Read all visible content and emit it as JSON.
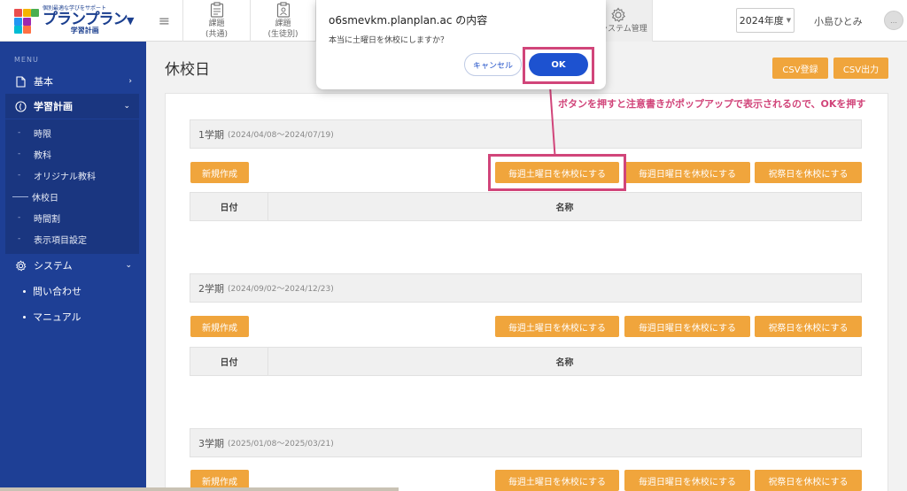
{
  "header": {
    "logo_tagline": "個別最適な学びをサポート",
    "logo_main": "プランプラン",
    "logo_sub": "学習計画",
    "tabs": [
      {
        "label1": "課題",
        "label2": "(共通)"
      },
      {
        "label1": "課題",
        "label2": "(生徒別)"
      }
    ],
    "system_tab_label": "システム管理",
    "year": "2024年度",
    "user_name": "小島ひとみ",
    "avatar_text": "…"
  },
  "sidebar": {
    "menu_label": "MENU",
    "basic": "基本",
    "study_plan": "学習計画",
    "sub_items": [
      "時限",
      "教科",
      "オリジナル教科",
      "休校日",
      "時間割",
      "表示項目設定"
    ],
    "system": "システム",
    "inquiry": "問い合わせ",
    "manual": "マニュアル"
  },
  "page": {
    "title": "休校日",
    "csv_import": "CSV登録",
    "csv_export": "CSV出力"
  },
  "terms": [
    {
      "name": "1学期",
      "dates": "(2024/04/08〜2024/07/19)"
    },
    {
      "name": "2学期",
      "dates": "(2024/09/02〜2024/12/23)"
    },
    {
      "name": "3学期",
      "dates": "(2025/01/08〜2025/03/21)"
    }
  ],
  "actions": {
    "new": "新規作成",
    "sat": "毎週土曜日を休校にする",
    "sun": "毎週日曜日を休校にする",
    "holiday": "祝祭日を休校にする"
  },
  "table": {
    "col_date": "日付",
    "col_name": "名称"
  },
  "dialog": {
    "title": "o6smevkm.planplan.ac の内容",
    "message": "本当に土曜日を休校にしますか？",
    "cancel": "キャンセル",
    "ok": "OK"
  },
  "annotation": {
    "text": "ボタンを押すと注意書きがポップアップで表示されるので、OKを押す"
  },
  "colors": {
    "sidebar": "#1e3f95",
    "accent_orange": "#f0a53c",
    "highlight": "#d1457a",
    "ok_blue": "#1d52d0"
  }
}
